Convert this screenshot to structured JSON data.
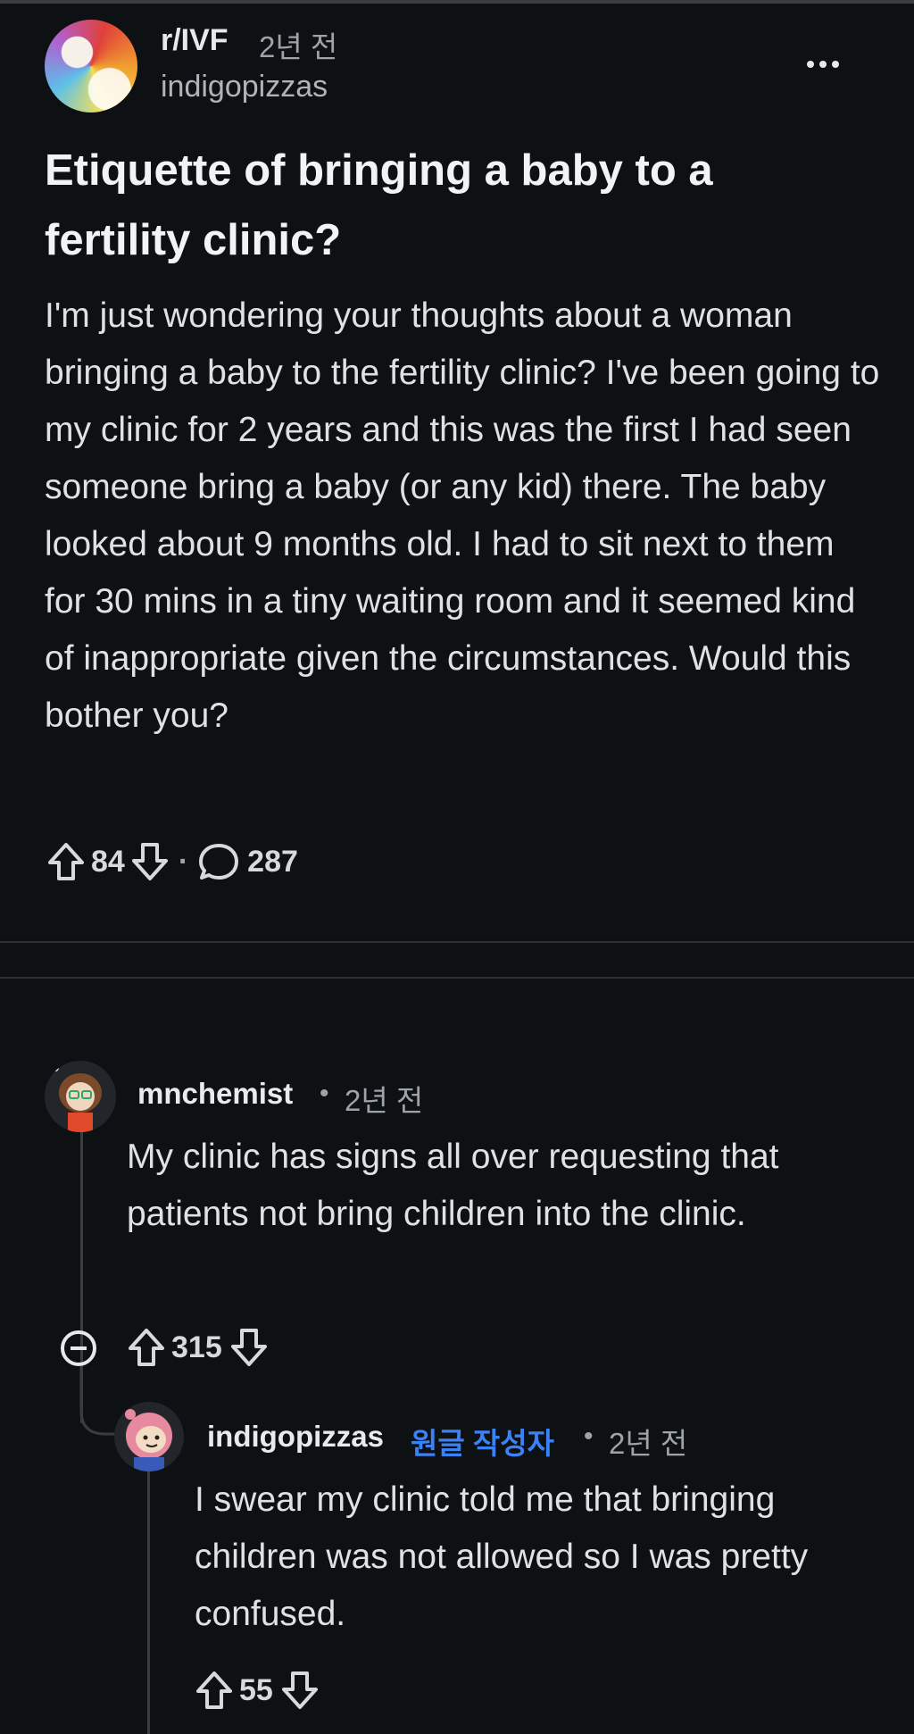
{
  "post": {
    "subreddit": "r/IVF",
    "time": "2년 전",
    "author": "indigopizzas",
    "title": "Etiquette of bringing a baby to a fertility clinic?",
    "body": "I'm just wondering your thoughts about a woman bringing a baby to the fertility clinic? I've been going to my clinic for 2 years and this was the first I had seen someone bring a baby (or any kid) there. The baby looked about 9 months old. I had to sit next to them for 30 mins in a tiny waiting room and it seemed kind of inappropriate given the circumstances. Would this bother you?",
    "upvotes": "84",
    "dot": "·",
    "comments": "287",
    "icons": [
      "more-icon",
      "upvote-icon",
      "downvote-icon",
      "comment-icon"
    ]
  },
  "comments": [
    {
      "author": "mnchemist",
      "dot": "•",
      "time": "2년 전",
      "body": "My clinic has signs all over requesting that patients not bring children into the clinic.",
      "upvotes": "315"
    },
    {
      "author": "indigopizzas",
      "op_badge": "원글 작성자",
      "dot": "•",
      "time": "2년 전",
      "body": "I swear my clinic told me that bringing children was not allowed so I was pretty confused.",
      "upvotes": "55"
    }
  ],
  "colors": {
    "background": "#0e1113",
    "op_badge": "#3b82f6",
    "text": "#d7dadc"
  }
}
